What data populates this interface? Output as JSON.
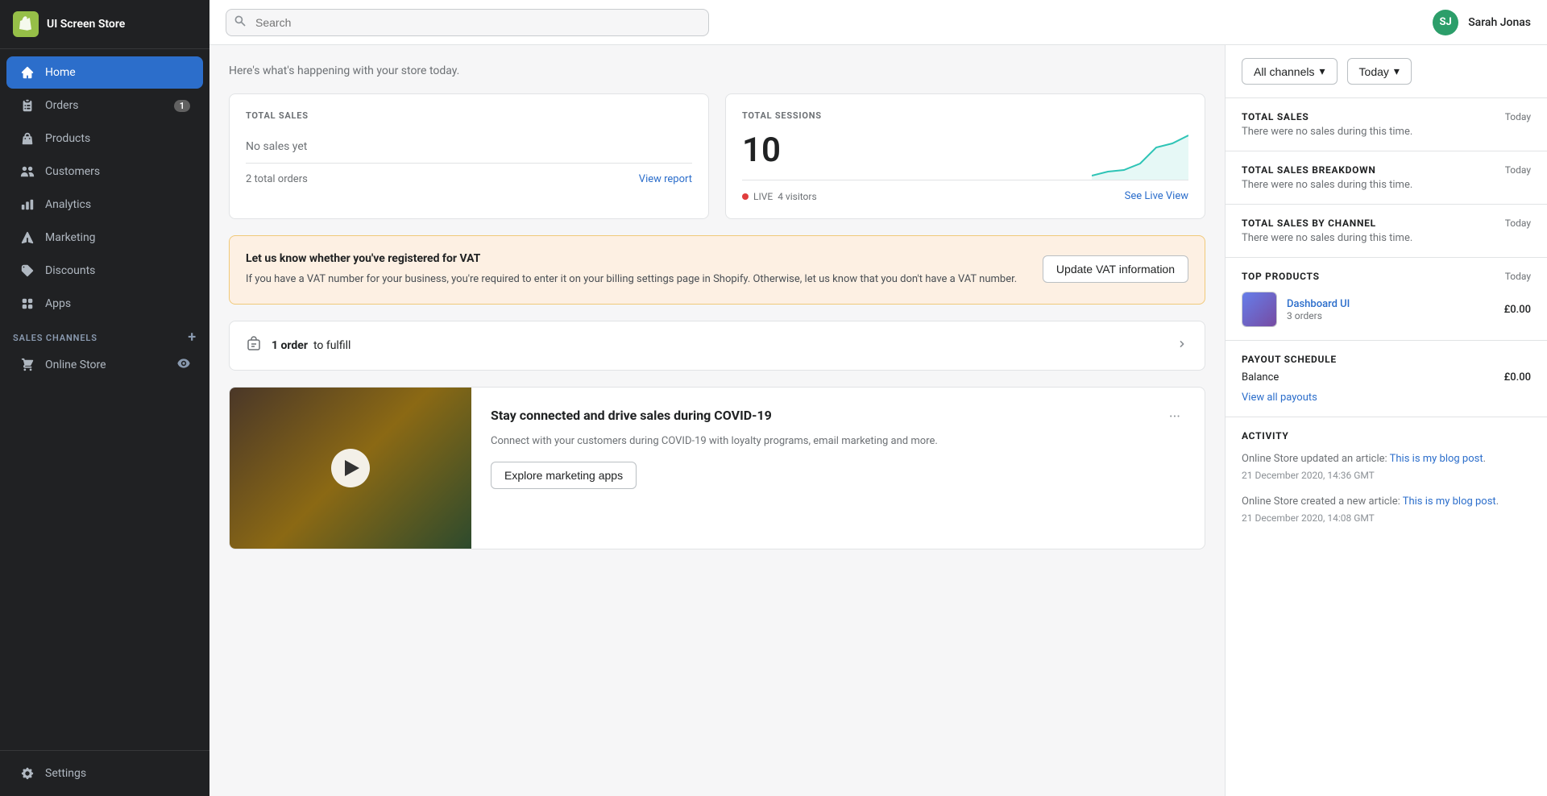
{
  "app": {
    "store_name": "UI Screen Store",
    "logo_alt": "Shopify Logo"
  },
  "topbar": {
    "search_placeholder": "Search",
    "user_initials": "SJ",
    "user_name": "Sarah Jonas"
  },
  "sidebar": {
    "nav_items": [
      {
        "id": "home",
        "label": "Home",
        "icon": "home-icon",
        "active": true,
        "badge": null
      },
      {
        "id": "orders",
        "label": "Orders",
        "icon": "orders-icon",
        "active": false,
        "badge": "1"
      },
      {
        "id": "products",
        "label": "Products",
        "icon": "products-icon",
        "active": false,
        "badge": null
      },
      {
        "id": "customers",
        "label": "Customers",
        "icon": "customers-icon",
        "active": false,
        "badge": null
      },
      {
        "id": "analytics",
        "label": "Analytics",
        "icon": "analytics-icon",
        "active": false,
        "badge": null
      },
      {
        "id": "marketing",
        "label": "Marketing",
        "icon": "marketing-icon",
        "active": false,
        "badge": null
      },
      {
        "id": "discounts",
        "label": "Discounts",
        "icon": "discounts-icon",
        "active": false,
        "badge": null
      },
      {
        "id": "apps",
        "label": "Apps",
        "icon": "apps-icon",
        "active": false,
        "badge": null
      }
    ],
    "sales_channels_label": "SALES CHANNELS",
    "channels": [
      {
        "id": "online-store",
        "label": "Online Store",
        "icon": "store-icon"
      }
    ],
    "settings_label": "Settings"
  },
  "main": {
    "subtitle": "Here's what's happening with your store today.",
    "total_sales_card": {
      "label": "TOTAL SALES",
      "no_sales_text": "No sales yet",
      "orders_text": "2 total orders",
      "view_report_link": "View report"
    },
    "total_sessions_card": {
      "label": "TOTAL SESSIONS",
      "value": "10",
      "live_label": "LIVE",
      "visitors_text": "4 visitors",
      "see_live_link": "See Live View"
    },
    "vat_banner": {
      "title": "Let us know whether you've registered for VAT",
      "text": "If you have a VAT number for your business, you're required to enter it on your billing settings page in Shopify. Otherwise, let us know that you don't have a VAT number.",
      "button_label": "Update VAT information"
    },
    "fulfill_card": {
      "orders_text": "1 order",
      "suffix_text": "to fulfill"
    },
    "blog_card": {
      "title": "Stay connected and drive sales during COVID-19",
      "description": "Connect with your customers during COVID-19 with loyalty programs, email marketing and more.",
      "explore_button": "Explore marketing apps"
    }
  },
  "right_panel": {
    "filter_all_channels": "All channels",
    "filter_today": "Today",
    "total_sales": {
      "title": "TOTAL SALES",
      "time": "Today",
      "text": "There were no sales during this time."
    },
    "total_sales_breakdown": {
      "title": "TOTAL SALES BREAKDOWN",
      "time": "Today",
      "text": "There were no sales during this time."
    },
    "total_sales_by_channel": {
      "title": "TOTAL SALES BY CHANNEL",
      "time": "Today",
      "text": "There were no sales during this time."
    },
    "top_products": {
      "title": "TOP PRODUCTS",
      "time": "Today",
      "product_name": "Dashboard UI",
      "product_orders": "3 orders",
      "product_price": "£0.00"
    },
    "payout_schedule": {
      "title": "PAYOUT SCHEDULE",
      "balance_label": "Balance",
      "balance_value": "£0.00",
      "view_payouts_link": "View all payouts"
    },
    "activity": {
      "title": "ACTIVITY",
      "items": [
        {
          "text_prefix": "Online Store updated an article: ",
          "link_text": "This is my blog post",
          "text_suffix": ".",
          "timestamp": "21 December 2020, 14:36 GMT"
        },
        {
          "text_prefix": "Online Store created a new article: ",
          "link_text": "This is my blog post",
          "text_suffix": ".",
          "timestamp": "21 December 2020, 14:08 GMT"
        }
      ]
    }
  }
}
